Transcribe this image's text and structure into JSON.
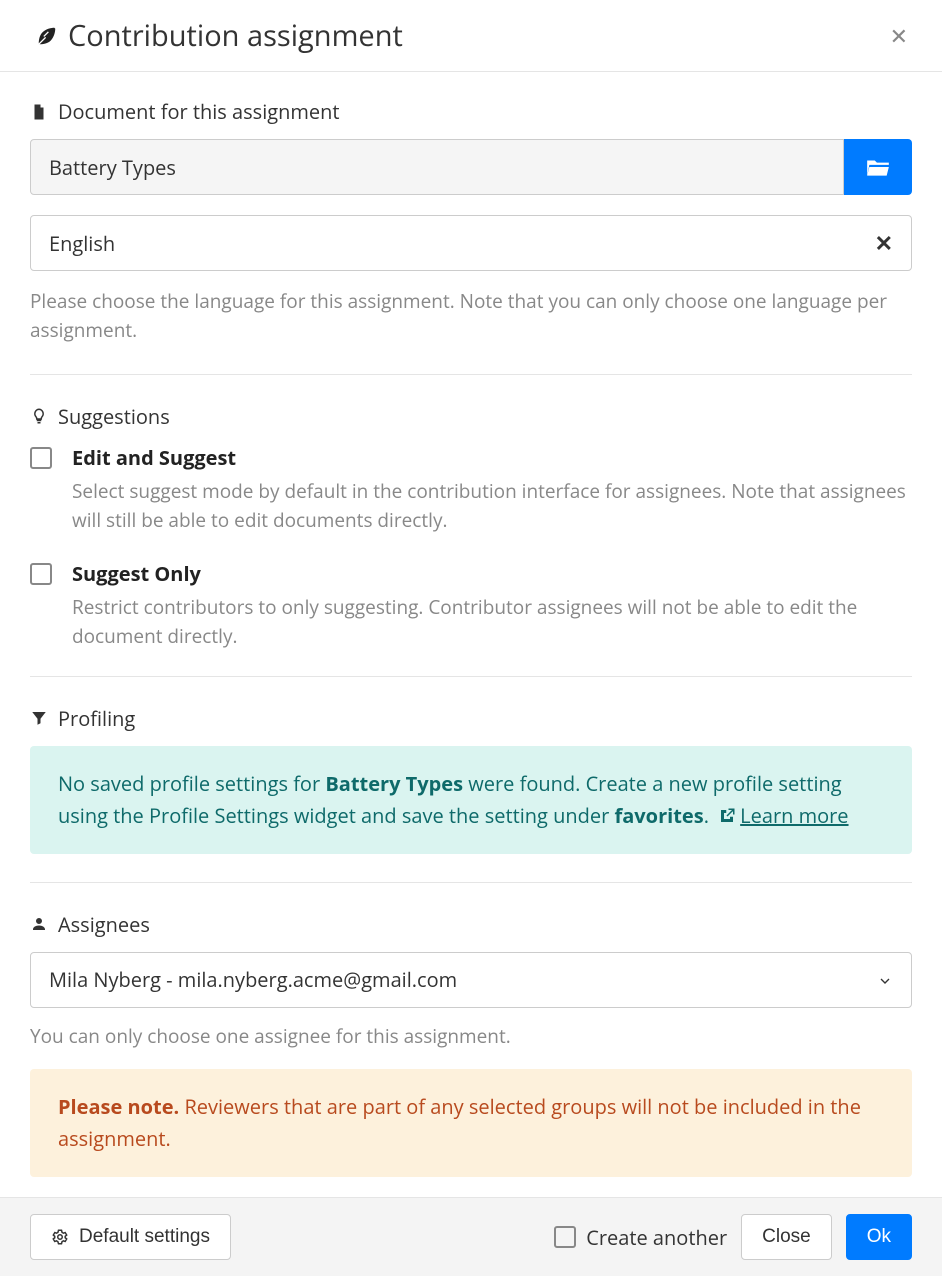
{
  "header": {
    "title": "Contribution assignment"
  },
  "document_section": {
    "title": "Document for this assignment",
    "document_value": "Battery Types",
    "language_value": "English",
    "language_help": "Please choose the language for this assignment. Note that you can only choose one language per assignment."
  },
  "suggestions_section": {
    "title": "Suggestions",
    "options": [
      {
        "label": "Edit and Suggest",
        "desc": "Select suggest mode by default in the contribution interface for assignees. Note that assignees will still be able to edit documents directly."
      },
      {
        "label": "Suggest Only",
        "desc": "Restrict contributors to only suggesting. Contributor assignees will not be able to edit the document directly."
      }
    ]
  },
  "profiling_section": {
    "title": "Profiling",
    "info_pre": "No saved profile settings for ",
    "info_bold1": "Battery Types",
    "info_mid": " were found. Create a new profile setting using the Profile Settings widget and save the setting under ",
    "info_bold2": "favorites",
    "info_post": ". ",
    "learn_more": "Learn more"
  },
  "assignees_section": {
    "title": "Assignees",
    "selected": "Mila Nyberg - mila.nyberg.acme@gmail.com",
    "help": "You can only choose one assignee for this assignment.",
    "warn_bold": "Please note.",
    "warn_rest": " Reviewers that are part of any selected groups will not be included in the assignment."
  },
  "footer": {
    "default_settings": "Default settings",
    "create_another": "Create another",
    "close": "Close",
    "ok": "Ok"
  }
}
